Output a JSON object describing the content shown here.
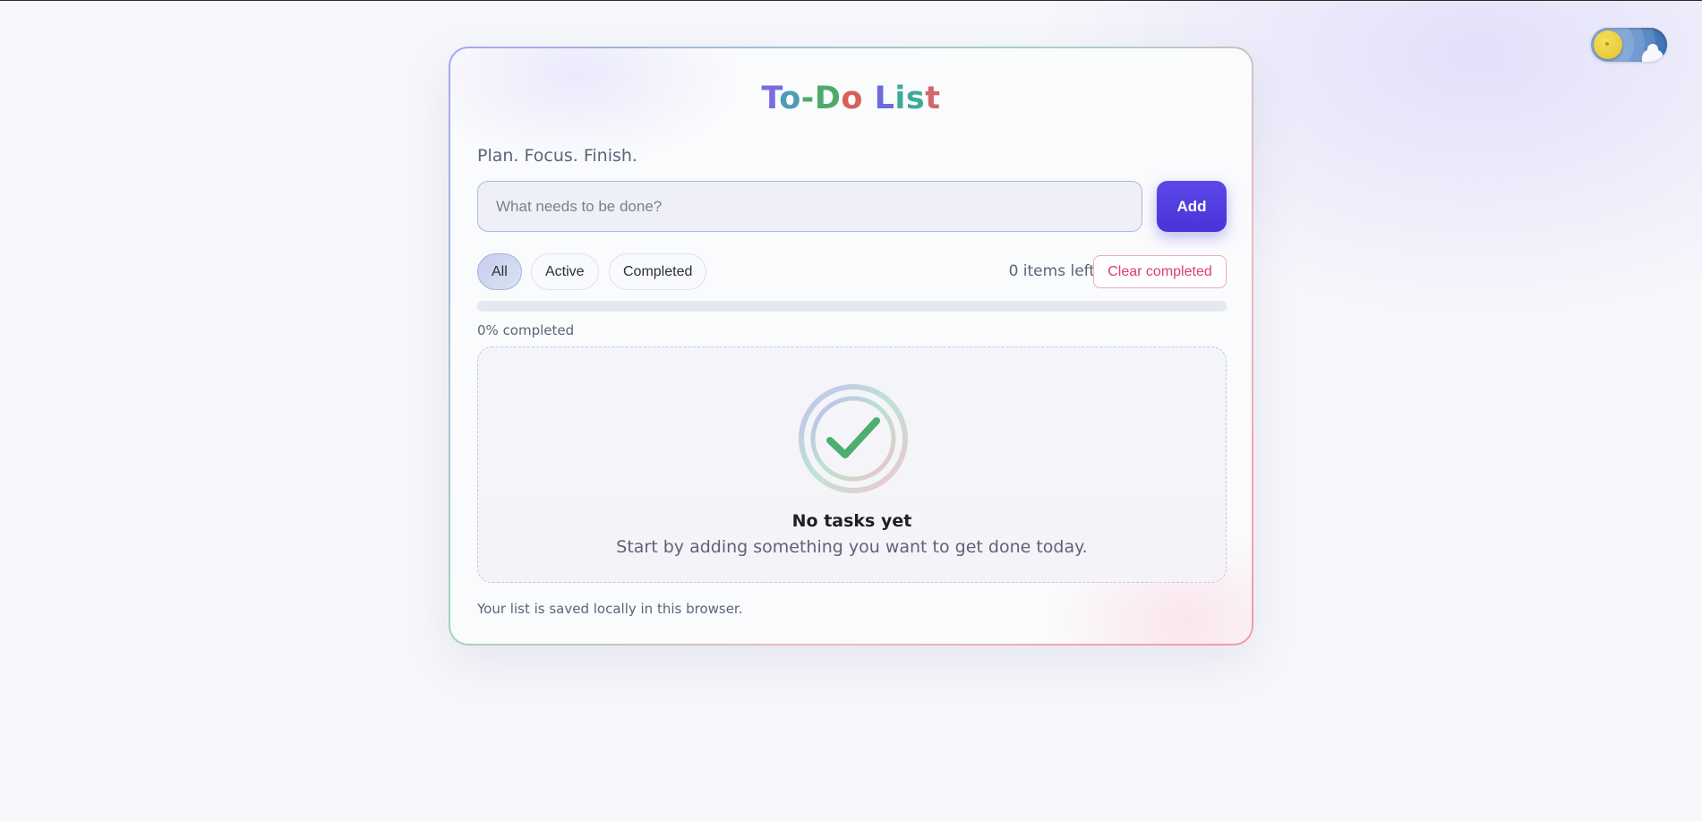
{
  "header": {
    "theme_toggle": {
      "icon": "sun-icon",
      "mode": "light"
    }
  },
  "app": {
    "title_parts": [
      "T",
      "o",
      "-",
      "D",
      "o",
      " L",
      "is",
      "t"
    ],
    "title": "To-Do List",
    "tagline": "Plan. Focus. Finish.",
    "input": {
      "placeholder": "What needs to be done?",
      "value": ""
    },
    "add_label": "Add",
    "filters": [
      {
        "label": "All",
        "active": true
      },
      {
        "label": "Active",
        "active": false
      },
      {
        "label": "Completed",
        "active": false
      }
    ],
    "items_left": "0 items left",
    "clear_label": "Clear completed",
    "progress": {
      "percent": 0,
      "label": "0% completed"
    },
    "empty": {
      "icon": "check-circle-icon",
      "title": "No tasks yet",
      "subtitle": "Start by adding something you want to get done today."
    },
    "footer_note": "Your list is saved locally in this browser."
  },
  "colors": {
    "accent": "#4a33d8",
    "danger": "#d9406a",
    "success": "#4caf6e"
  }
}
